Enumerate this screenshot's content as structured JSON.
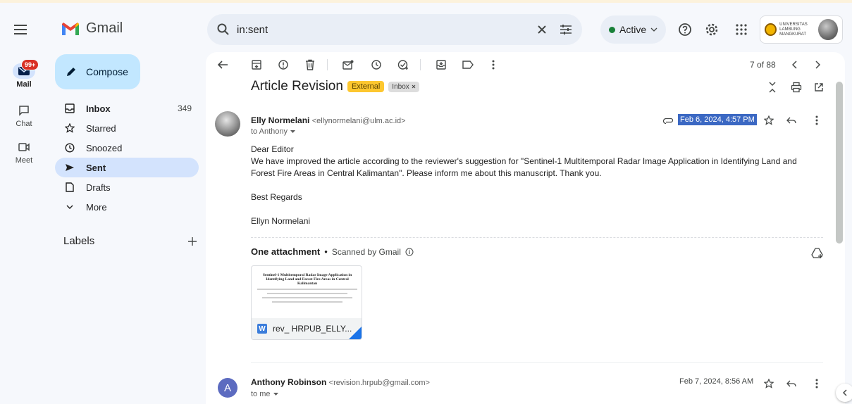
{
  "app": {
    "name": "Gmail"
  },
  "rail": {
    "mail_label": "Mail",
    "mail_badge": "99+",
    "chat_label": "Chat",
    "meet_label": "Meet"
  },
  "search": {
    "value": "in:sent"
  },
  "status": {
    "label": "Active",
    "color": "#188038"
  },
  "account": {
    "org_text": "UNIVERSITAS LAMBUNG MANGKURAT"
  },
  "compose": {
    "label": "Compose"
  },
  "nav": {
    "inbox": {
      "label": "Inbox",
      "count": "349"
    },
    "starred": {
      "label": "Starred"
    },
    "snoozed": {
      "label": "Snoozed"
    },
    "sent": {
      "label": "Sent"
    },
    "drafts": {
      "label": "Drafts"
    },
    "more": {
      "label": "More"
    }
  },
  "labels": {
    "title": "Labels"
  },
  "pager": {
    "text": "7 of 88"
  },
  "thread": {
    "subject": "Article Revision",
    "label_external": "External",
    "label_inbox": "Inbox"
  },
  "message1": {
    "sender_name": "Elly Normelani",
    "sender_email": "<ellynormelani@ulm.ac.id>",
    "to": "to Anthony",
    "date": "Feb 6, 2024, 4:57 PM",
    "body": [
      "Dear Editor",
      "We have improved the article according to the reviewer's suggestion for \"Sentinel-1 Multitemporal Radar Image Application in Identifying Land and Forest Fire Areas in Central Kalimantan\". Please inform me about this manuscript. Thank you.",
      "",
      "Best Regards",
      "",
      "Ellyn Normelani"
    ]
  },
  "attachment": {
    "header": "One attachment",
    "scanned": "Scanned by Gmail",
    "preview_title": "Sentinel-1 Multitemporal Radar Image Application in Identifying Land and Forest Fire Areas in Central Kalimantan",
    "file_name": "rev_ HRPUB_ELLY...",
    "type_letter": "W"
  },
  "message2": {
    "avatar_letter": "A",
    "sender_name": "Anthony Robinson",
    "sender_email": "<revision.hrpub@gmail.com>",
    "to": "to me",
    "date": "Feb 7, 2024, 8:56 AM"
  }
}
